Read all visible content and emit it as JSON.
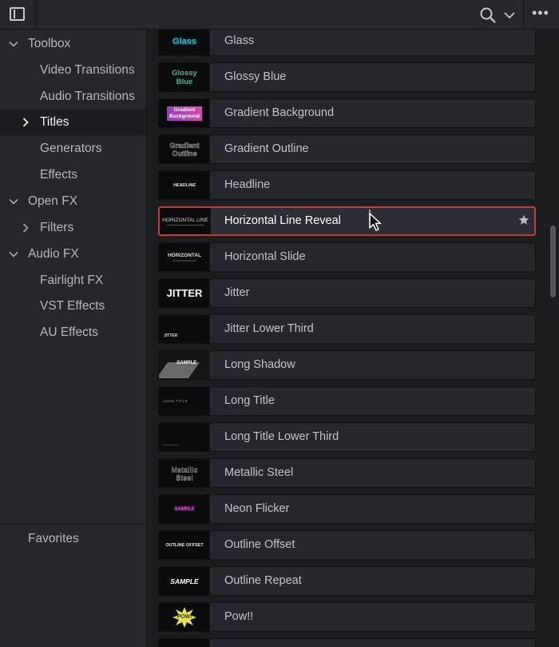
{
  "toolbar": {
    "panel_icon": "panel-toggle-icon",
    "search_icon": "search-icon",
    "dropdown_icon": "chevron-down-icon",
    "more_label": "•••"
  },
  "sidebar": {
    "items": [
      {
        "label": "Toolbox",
        "arrow": "chevron-down"
      },
      {
        "label": "Video Transitions"
      },
      {
        "label": "Audio Transitions"
      },
      {
        "label": "Titles",
        "arrow": "chevron-right",
        "selected": true
      },
      {
        "label": "Generators"
      },
      {
        "label": "Effects"
      },
      {
        "label": "Open FX",
        "arrow": "chevron-down"
      },
      {
        "label": "Filters",
        "arrow": "chevron-right"
      },
      {
        "label": "Audio FX",
        "arrow": "chevron-down"
      },
      {
        "label": "Fairlight FX"
      },
      {
        "label": "VST Effects"
      },
      {
        "label": "AU Effects"
      }
    ],
    "favorites_label": "Favorites"
  },
  "titles": {
    "items": [
      {
        "name": "Glass",
        "thumb_text": "Glass"
      },
      {
        "name": "Glossy Blue",
        "thumb_text": "Glossy Blue"
      },
      {
        "name": "Gradient Background",
        "thumb_text": "Gradient Background"
      },
      {
        "name": "Gradient Outline",
        "thumb_text": "Gradient Outline"
      },
      {
        "name": "Headline",
        "thumb_text": "HEADLINE"
      },
      {
        "name": "Horizontal Line Reveal",
        "thumb_text": "HORIZONTAL LINE",
        "selected": true
      },
      {
        "name": "Horizontal Slide",
        "thumb_text": "HORIZONTAL"
      },
      {
        "name": "Jitter",
        "thumb_text": "JITTER"
      },
      {
        "name": "Jitter Lower Third",
        "thumb_text": "JITTER"
      },
      {
        "name": "Long Shadow",
        "thumb_text": "SAMPLE"
      },
      {
        "name": "Long Title",
        "thumb_text": "LONG TITLE"
      },
      {
        "name": "Long Title Lower Third",
        "thumb_text": ""
      },
      {
        "name": "Metallic Steel",
        "thumb_text": "Metallic Steel"
      },
      {
        "name": "Neon Flicker",
        "thumb_text": "SAMPLE"
      },
      {
        "name": "Outline Offset",
        "thumb_text": "OUTLINE OFFSET"
      },
      {
        "name": "Outline Repeat",
        "thumb_text": "SAMPLE"
      },
      {
        "name": "Pow!!",
        "thumb_text": "POW!"
      }
    ]
  },
  "colors": {
    "selection_border": "#c23b3b",
    "panel_bg": "#26272c",
    "list_bg": "#1c1d21"
  }
}
